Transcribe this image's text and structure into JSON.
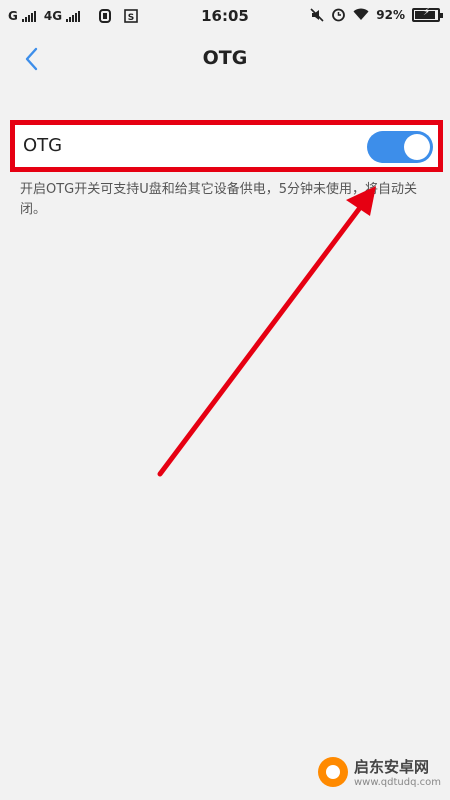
{
  "status_bar": {
    "carrier1": "G",
    "carrier2": "4G",
    "time": "16:05",
    "battery": "92%",
    "battery_level": 0.92,
    "icons": [
      "signal-icon",
      "signal-icon",
      "app-icon",
      "app-icon",
      "mute-icon",
      "alarm-icon",
      "wifi-icon",
      "battery-icon"
    ]
  },
  "header": {
    "back_icon": "chevron-left-icon",
    "title": "OTG"
  },
  "setting": {
    "label": "OTG",
    "toggle_on": true,
    "description": "开启OTG开关可支持U盘和给其它设备供电，5分钟未使用，将自动关闭。"
  },
  "colors": {
    "accent": "#3d8eea",
    "annotation": "#e60012",
    "background": "#f2f2f2"
  },
  "watermark": {
    "title": "启东安卓网",
    "url": "www.qdtudq.com"
  }
}
